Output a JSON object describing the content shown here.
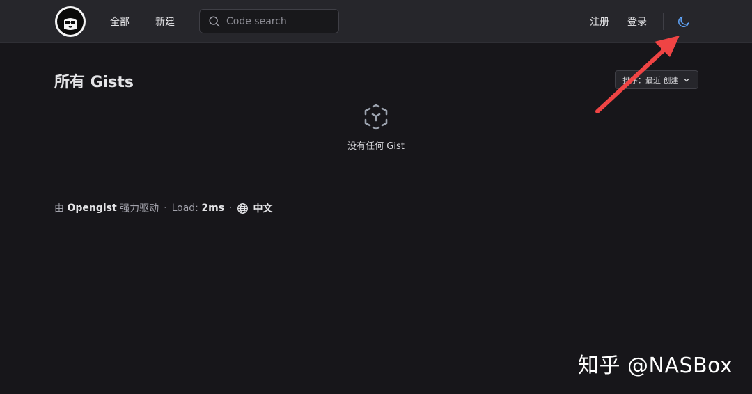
{
  "nav": {
    "all_label": "全部",
    "new_label": "新建",
    "search_placeholder": "Code search",
    "register_label": "注册",
    "login_label": "登录",
    "theme_icon": "moon-icon"
  },
  "main": {
    "title": "所有 Gists",
    "sort_label": "排序：最近 创建",
    "empty_icon": "cube-icon",
    "empty_text": "没有任何 Gist"
  },
  "footer": {
    "powered_prefix": "由",
    "powered_name": "Opengist",
    "powered_suffix": "强力驱动",
    "load_label": "Load:",
    "load_value": "2ms",
    "language": "中文"
  },
  "watermark": "知乎 @NASBox",
  "colors": {
    "background": "#17161a",
    "header": "#26262b",
    "accent": "#60a5fa",
    "arrow": "#ef4444"
  }
}
